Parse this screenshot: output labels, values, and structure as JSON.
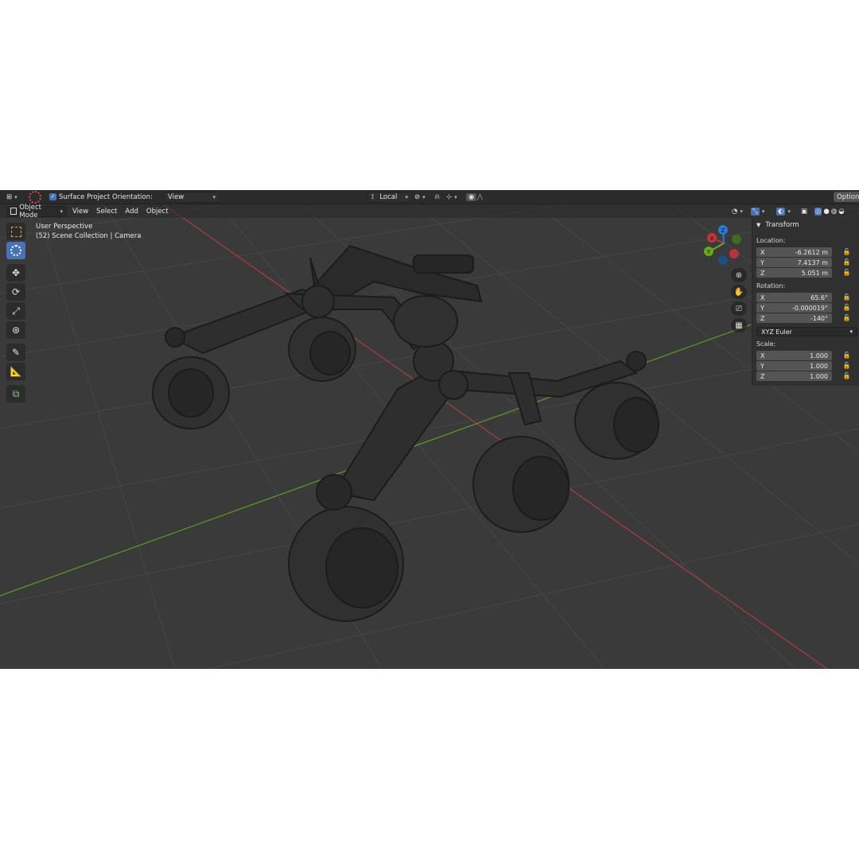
{
  "header": {
    "surface_project_label": "Surface Project",
    "surface_project_checked": true,
    "orientation_label": "Orientation:",
    "orientation_value": "View",
    "pivot_value": "Local",
    "options_label": "Options"
  },
  "menubar": {
    "mode": "Object Mode",
    "items": [
      "View",
      "Select",
      "Add",
      "Object"
    ]
  },
  "viewport": {
    "perspective": "User Perspective",
    "collection_info": "(52) Scene Collection | Camera",
    "gizmo_axes": [
      "X",
      "Y",
      "Z"
    ]
  },
  "toolbar": {
    "tools": [
      "select-box",
      "cursor",
      "move",
      "rotate",
      "scale",
      "transform",
      "annotate",
      "measure",
      "add-cube"
    ],
    "active_tool": "cursor"
  },
  "transform_panel": {
    "title": "Transform",
    "location_label": "Location:",
    "location": [
      {
        "axis": "X",
        "value": "-6.2612 m"
      },
      {
        "axis": "Y",
        "value": "7.4137 m"
      },
      {
        "axis": "Z",
        "value": "5.051 m"
      }
    ],
    "rotation_label": "Rotation:",
    "rotation": [
      {
        "axis": "X",
        "value": "65.6°"
      },
      {
        "axis": "Y",
        "value": "-0.000019°"
      },
      {
        "axis": "Z",
        "value": "-140°"
      }
    ],
    "rotation_mode": "XYZ Euler",
    "scale_label": "Scale:",
    "scale": [
      {
        "axis": "X",
        "value": "1.000"
      },
      {
        "axis": "Y",
        "value": "1.000"
      },
      {
        "axis": "Z",
        "value": "1.000"
      }
    ]
  },
  "colors": {
    "x_axis": "#c8323c",
    "y_axis": "#6ca51f",
    "z_axis": "#2a7bd6",
    "active": "#4772b3",
    "viewport_bg": "#3a3a3a"
  }
}
